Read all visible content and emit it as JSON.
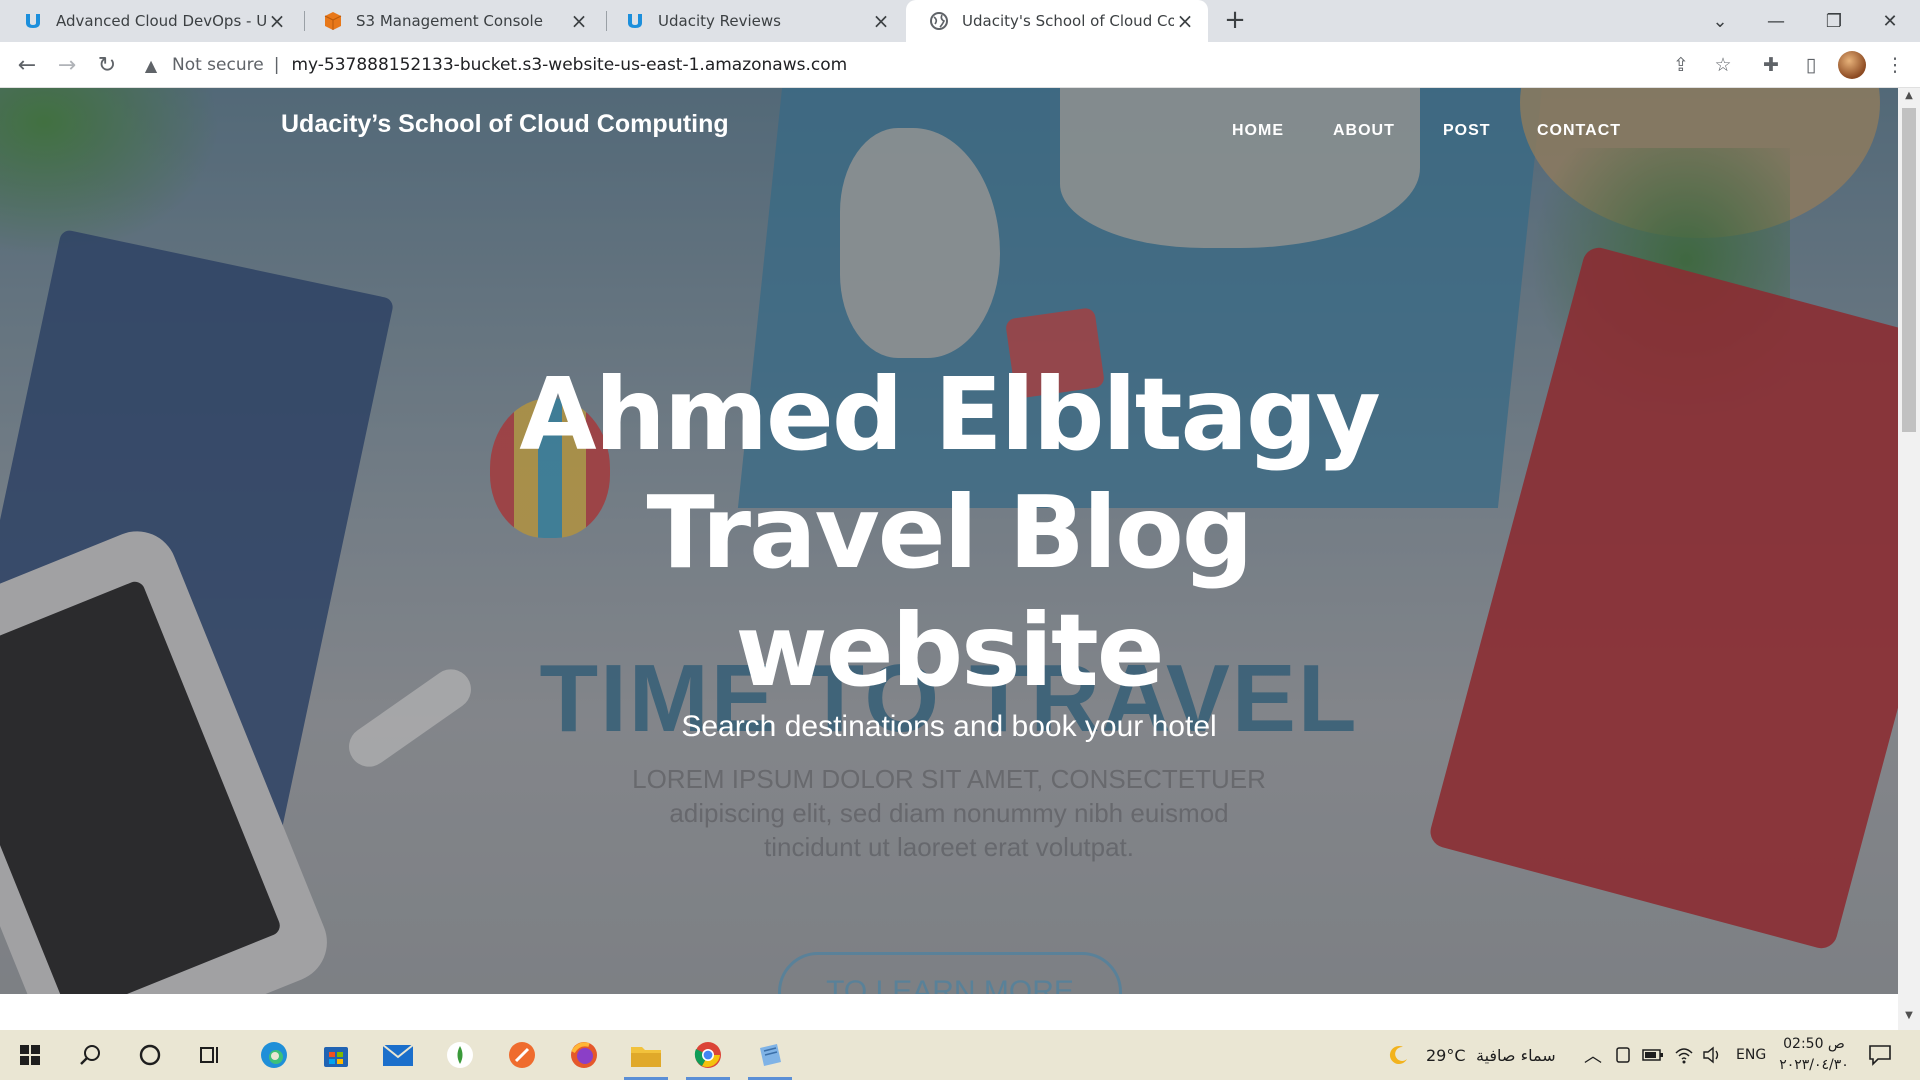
{
  "browser": {
    "tabs": [
      {
        "title": "Advanced Cloud DevOps - Udaci",
        "favicon": "udacity-icon",
        "active": false
      },
      {
        "title": "S3 Management Console",
        "favicon": "aws-cube-icon",
        "active": false
      },
      {
        "title": "Udacity Reviews",
        "favicon": "udacity-icon",
        "active": false
      },
      {
        "title": "Udacity's School of Cloud Compu",
        "favicon": "globe-icon",
        "active": true
      }
    ],
    "security_label": "Not secure",
    "url": "my-537888152133-bucket.s3-website-us-east-1.amazonaws.com"
  },
  "site": {
    "brand": "Udacity’s School of Cloud Computing",
    "nav": [
      "HOME",
      "ABOUT",
      "POST",
      "CONTACT"
    ],
    "hero": {
      "title_lines": [
        "Ahmed Elbltagy",
        "Travel Blog",
        "website"
      ],
      "subtitle": "Search destinations and book your hotel",
      "button": "TO LEARN MORE"
    },
    "background_artwork": {
      "headline": "TIME TO TRAVEL",
      "lorem_lines": [
        "LOREM IPSUM DOLOR SIT AMET, CONSECTETUER",
        "adipiscing elit, sed diam nonummy nibh euismod",
        "tincidunt ut laoreet erat volutpat."
      ]
    }
  },
  "taskbar": {
    "apps": [
      "start-icon",
      "search-icon",
      "cortana-icon",
      "task-view-icon",
      "edge-icon",
      "store-icon",
      "mail-icon",
      "android-icon",
      "postman-icon",
      "firefox-icon",
      "file-explorer-icon",
      "chrome-icon",
      "notepad-icon"
    ],
    "weather_temp": "29°C",
    "weather_desc": "سماء صافية",
    "language": "ENG",
    "time": "02:50 ص",
    "date": "٢٠٢٣/٠٤/٣٠"
  },
  "colors": {
    "tabstrip": "#dee1e6",
    "taskbar": "#eae6d3",
    "hero_blue": "#2f7fa8"
  }
}
